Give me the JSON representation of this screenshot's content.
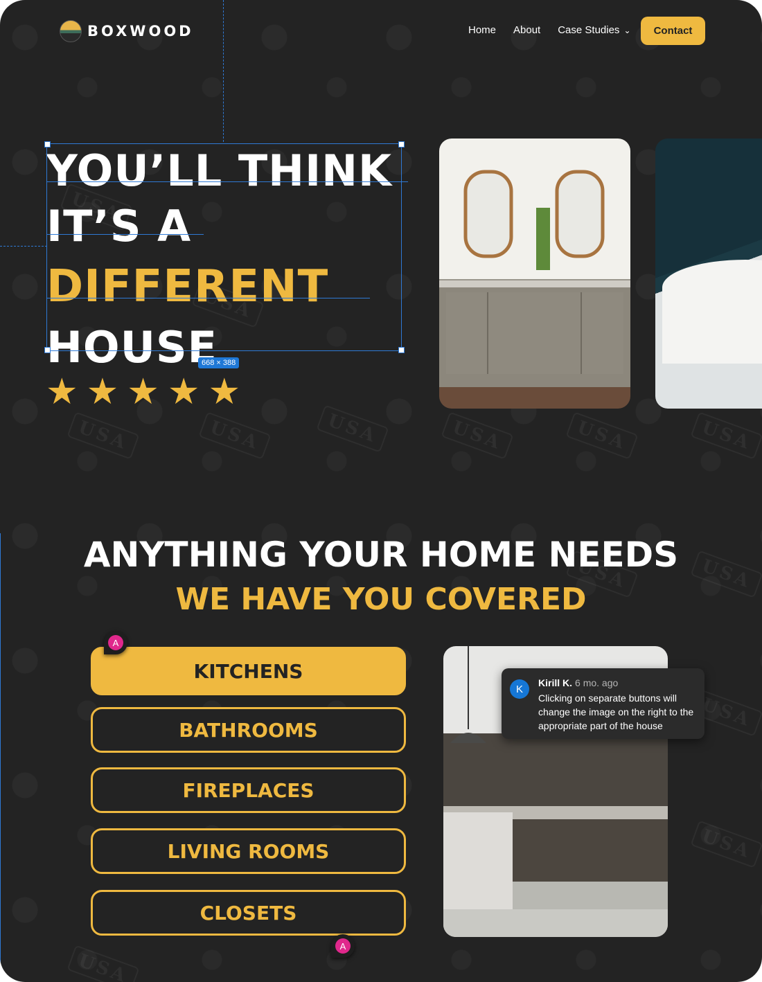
{
  "nav": {
    "brand": "BOXWOOD",
    "links": [
      "Home",
      "About",
      "Case Studies"
    ],
    "contact": "Contact"
  },
  "hero": {
    "title_lines": [
      "YOU’LL THINK",
      "IT’S A",
      "DIFFERENT",
      "HOUSE"
    ],
    "rating": 5,
    "selection_size": "668 × 388"
  },
  "services": {
    "heading": "ANYTHING YOUR HOME NEEDS",
    "subheading": "WE HAVE YOU COVERED",
    "categories": [
      "KITCHENS",
      "BATHROOMS",
      "FIREPLACES",
      "LIVING ROOMS",
      "CLOSETS"
    ]
  },
  "comment": {
    "initial": "K",
    "author": "Kirill K.",
    "time": "6 mo. ago",
    "text": "Clicking on separate buttons will change the image on the right to the appropriate part of the house"
  },
  "markers": [
    "A",
    "A"
  ],
  "colors": {
    "accent": "#efb940",
    "background": "#232323",
    "guide": "#2f7ad6",
    "marker": "#e0288c"
  }
}
